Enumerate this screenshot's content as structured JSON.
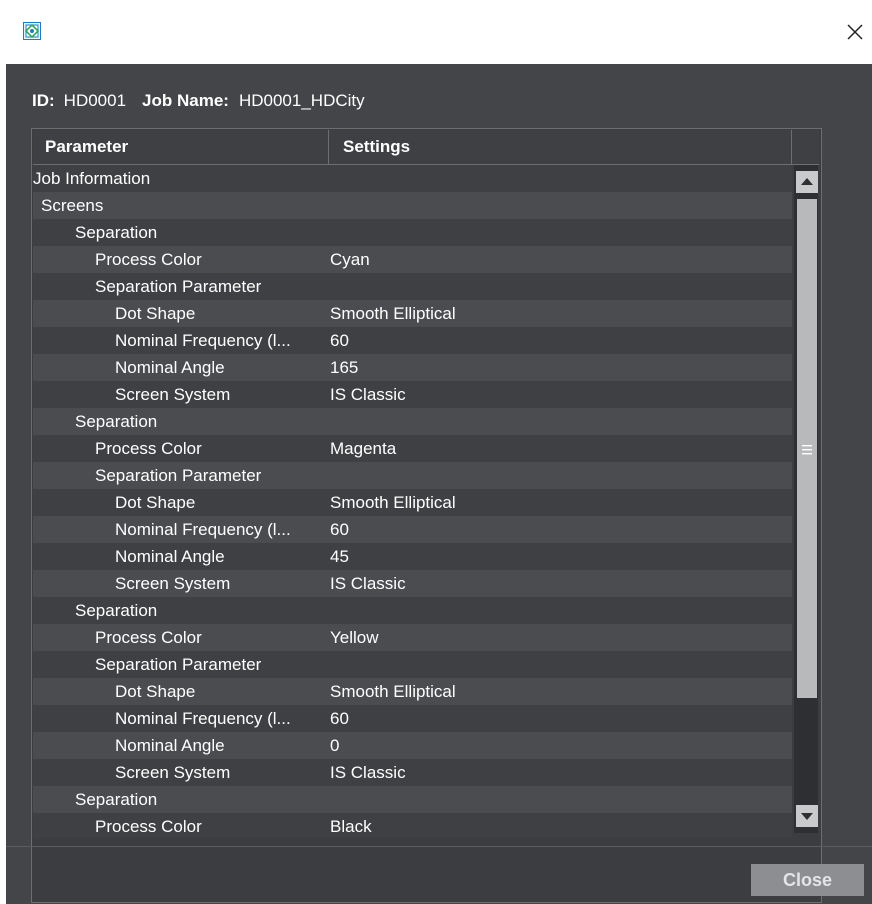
{
  "header": {
    "id_label": "ID:",
    "id_value": "HD0001",
    "job_name_label": "Job Name:",
    "job_name_value": "HD0001_HDCity"
  },
  "table": {
    "columns": [
      "Parameter",
      "Settings"
    ],
    "rows": [
      {
        "parameter": "Job Information",
        "settings": "",
        "level": 0
      },
      {
        "parameter": "Screens",
        "settings": "",
        "level": 1
      },
      {
        "parameter": "Separation",
        "settings": "",
        "level": 2
      },
      {
        "parameter": "Process Color",
        "settings": "Cyan",
        "level": 3
      },
      {
        "parameter": "Separation Parameter",
        "settings": "",
        "level": 3
      },
      {
        "parameter": "Dot Shape",
        "settings": "Smooth Elliptical",
        "level": 4
      },
      {
        "parameter": "Nominal Frequency (l...",
        "settings": "60",
        "level": 4
      },
      {
        "parameter": "Nominal Angle",
        "settings": "165",
        "level": 4
      },
      {
        "parameter": "Screen System",
        "settings": "IS Classic",
        "level": 4
      },
      {
        "parameter": "Separation",
        "settings": "",
        "level": 2
      },
      {
        "parameter": "Process Color",
        "settings": "Magenta",
        "level": 3
      },
      {
        "parameter": "Separation Parameter",
        "settings": "",
        "level": 3
      },
      {
        "parameter": "Dot Shape",
        "settings": "Smooth Elliptical",
        "level": 4
      },
      {
        "parameter": "Nominal Frequency (l...",
        "settings": "60",
        "level": 4
      },
      {
        "parameter": "Nominal Angle",
        "settings": "45",
        "level": 4
      },
      {
        "parameter": "Screen System",
        "settings": "IS Classic",
        "level": 4
      },
      {
        "parameter": "Separation",
        "settings": "",
        "level": 2
      },
      {
        "parameter": "Process Color",
        "settings": "Yellow",
        "level": 3
      },
      {
        "parameter": "Separation Parameter",
        "settings": "",
        "level": 3
      },
      {
        "parameter": "Dot Shape",
        "settings": "Smooth Elliptical",
        "level": 4
      },
      {
        "parameter": "Nominal Frequency (l...",
        "settings": "60",
        "level": 4
      },
      {
        "parameter": "Nominal Angle",
        "settings": "0",
        "level": 4
      },
      {
        "parameter": "Screen System",
        "settings": "IS Classic",
        "level": 4
      },
      {
        "parameter": "Separation",
        "settings": "",
        "level": 2
      },
      {
        "parameter": "Process Color",
        "settings": "Black",
        "level": 3
      }
    ]
  },
  "footer": {
    "close_label": "Close"
  },
  "icons": {
    "app": "app-icon",
    "window_close": "close-icon",
    "scroll_up": "scroll-up-arrow-icon",
    "scroll_down": "scroll-down-arrow-icon",
    "scroll_grip": "grip-icon"
  },
  "colors": {
    "window_bg": "#434549",
    "row_alt": "#4a4c50",
    "row_base": "#3e4043",
    "close_button": "#8c8e91"
  }
}
